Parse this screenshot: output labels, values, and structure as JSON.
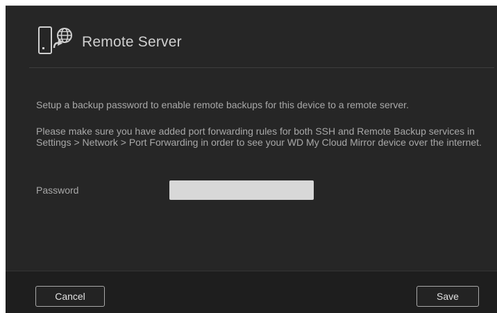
{
  "dialog": {
    "title": "Remote Server",
    "icons": {
      "header": "device-globe-icon"
    },
    "description": "Setup a backup password to enable remote backups for this device to a remote server.",
    "port_forwarding_note": "Please make sure you have added port forwarding rules for both SSH and Remote Backup services in Settings > Network > Port Forwarding in order to see your WD My Cloud Mirror device over the internet.",
    "password": {
      "label": "Password",
      "value": "",
      "placeholder": ""
    },
    "buttons": {
      "cancel": "Cancel",
      "save": "Save"
    }
  },
  "colors": {
    "background": "#262626",
    "footer": "#1e1e1e",
    "text": "#a8a8a8",
    "title": "#cfcfcf",
    "input": "#d8d8d8"
  }
}
